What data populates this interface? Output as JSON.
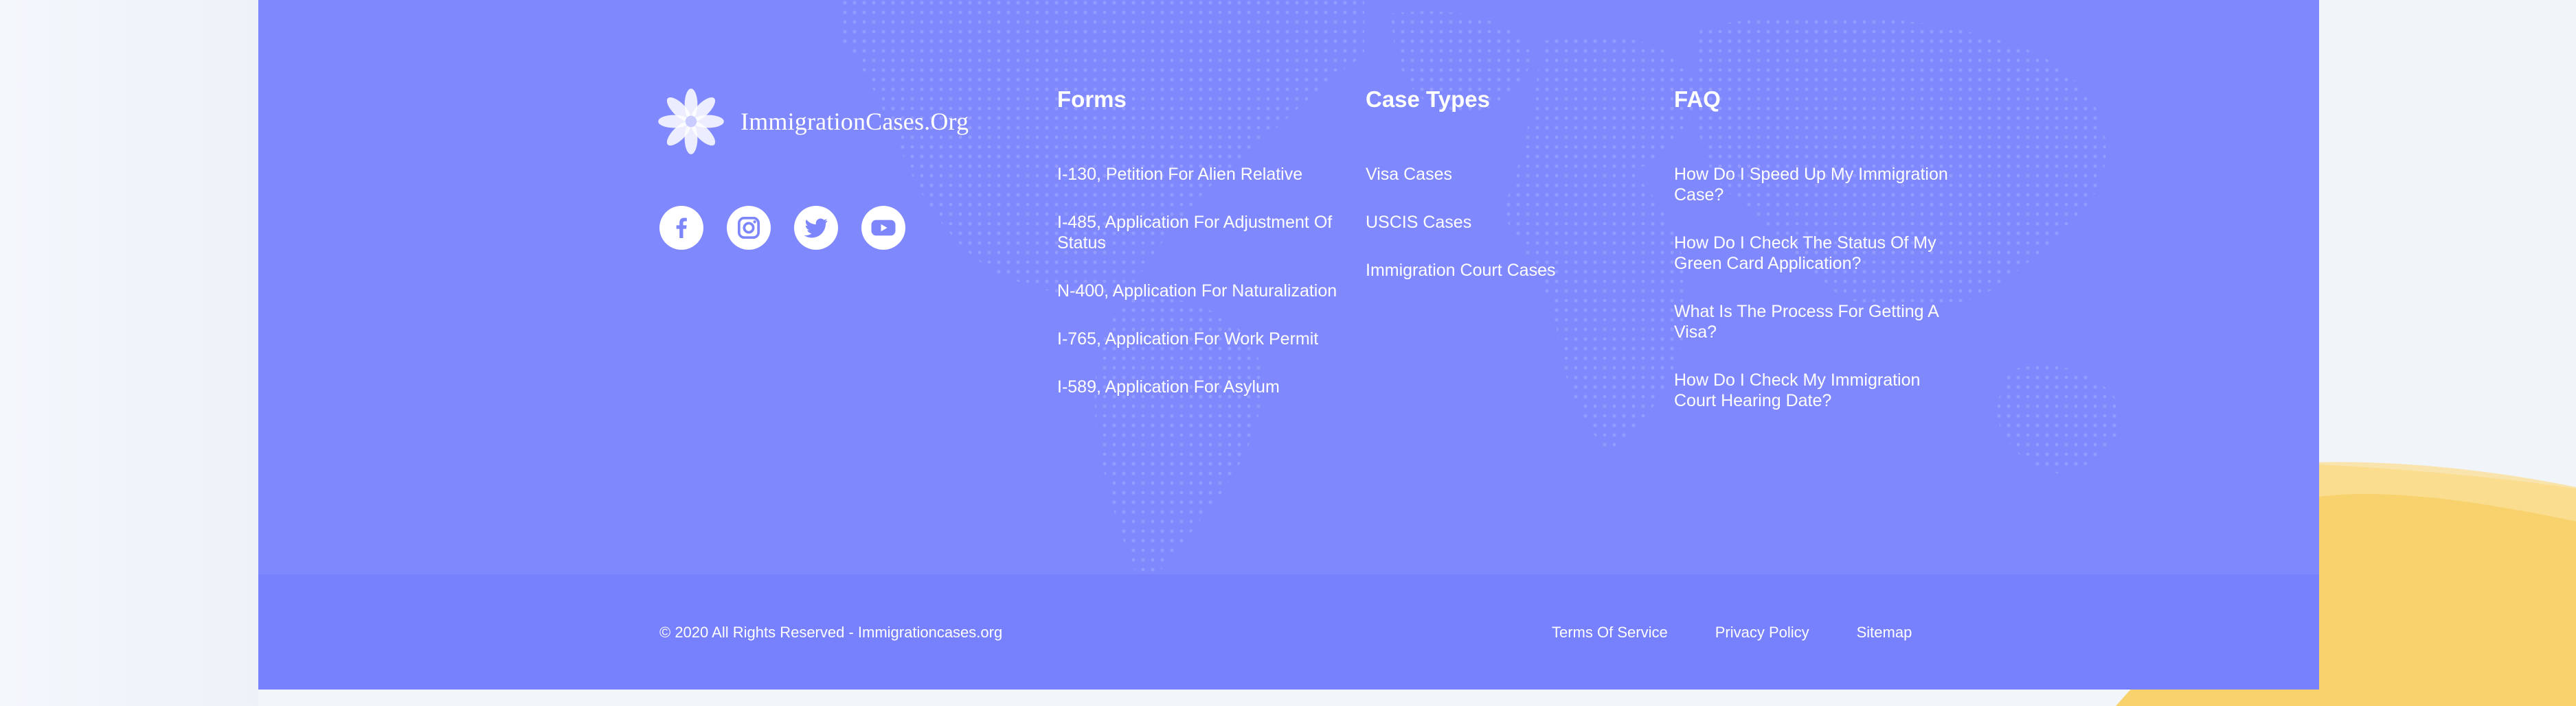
{
  "brand": {
    "name": "ImmigrationCases.Org",
    "logo_icon": "flower-icon"
  },
  "social": [
    {
      "icon": "facebook-icon"
    },
    {
      "icon": "instagram-icon"
    },
    {
      "icon": "twitter-icon"
    },
    {
      "icon": "youtube-icon"
    }
  ],
  "columns": {
    "forms": {
      "title": "Forms",
      "links": [
        "I-130, Petition For Alien Relative",
        "I-485, Application For Adjustment Of Status",
        "N-400, Application For Naturalization",
        "I-765, Application For Work Permit",
        "I-589, Application For Asylum"
      ]
    },
    "case_types": {
      "title": "Case Types",
      "links": [
        "Visa Cases",
        "USCIS Cases",
        "Immigration Court Cases"
      ]
    },
    "faq": {
      "title": "FAQ",
      "links": [
        "How Do I Speed Up My Immigration Case?",
        "How Do I Check The Status Of My Green Card Application?",
        "What Is The Process For Getting A Visa?",
        "How Do I Check My Immigration Court Hearing Date?"
      ]
    }
  },
  "bottom_bar": {
    "copyright": "© 2020 All Rights Reserved - Immigrationcases.org",
    "links": [
      "Terms Of Service",
      "Privacy Policy",
      "Sitemap"
    ]
  },
  "colors": {
    "footer_bg": "#8088fe",
    "bottom_bar_bg": "#7780fd",
    "page_bg": "#f2f6fb",
    "accent_yellow": "#f8d26c",
    "text": "#ffffff"
  }
}
